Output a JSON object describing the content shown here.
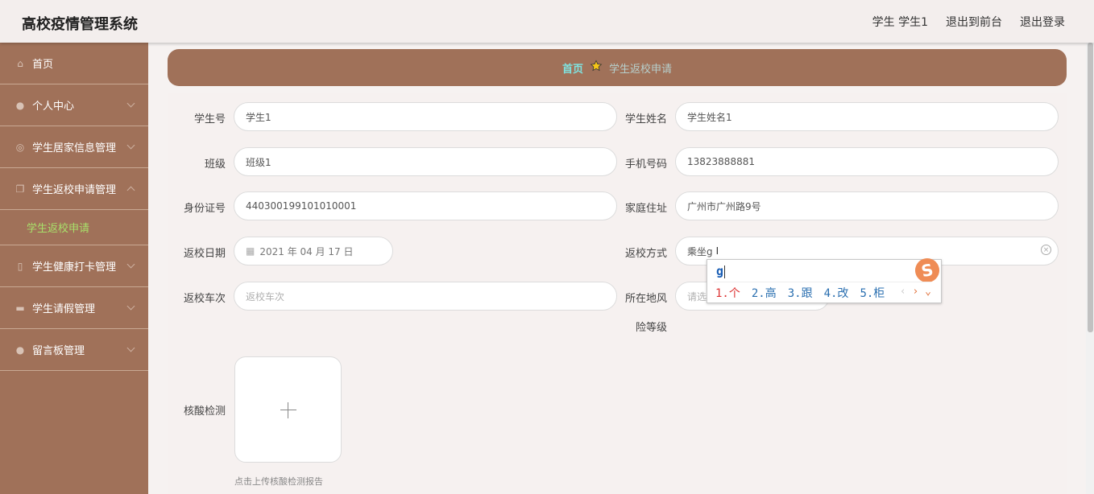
{
  "app": {
    "title": "高校疫情管理系统"
  },
  "topnav": {
    "user": "学生 学生1",
    "front": "退出到前台",
    "logout": "退出登录"
  },
  "sidebar": {
    "items": [
      {
        "label": "首页",
        "icon": "home-icon"
      },
      {
        "label": "个人中心",
        "icon": "user-icon"
      },
      {
        "label": "学生居家信息管理",
        "icon": "settings-icon"
      },
      {
        "label": "学生返校申请管理",
        "icon": "copy-icon"
      },
      {
        "label": "学生健康打卡管理",
        "icon": "phone-icon"
      },
      {
        "label": "学生请假管理",
        "icon": "chat-icon"
      },
      {
        "label": "留言板管理",
        "icon": "user-icon"
      }
    ],
    "sub_item": "学生返校申请"
  },
  "breadcrumb": {
    "home": "首页",
    "current": "学生返校申请"
  },
  "form": {
    "student_no_label": "学生号",
    "student_no": "学生1",
    "student_name_label": "学生姓名",
    "student_name": "学生姓名1",
    "class_label": "班级",
    "class": "班级1",
    "phone_label": "手机号码",
    "phone": "13823888881",
    "id_label": "身份证号",
    "id": "440300199101010001",
    "address_label": "家庭住址",
    "address": "广州市广州路9号",
    "return_date_label": "返校日期",
    "return_date": "2021 年 04 月 17 日",
    "return_method_label": "返校方式",
    "return_method": "乘坐g",
    "train_label": "返校车次",
    "train_placeholder": "返校车次",
    "risk_label_1": "所在地风",
    "risk_label_2": "险等级",
    "risk_placeholder": "请选",
    "nucleic_label": "核酸检测",
    "upload_hint": "点击上传核酸检测报告"
  },
  "ime": {
    "composition": "g",
    "candidates": [
      "1.个",
      "2.高",
      "3.跟",
      "4.改",
      "5.柜"
    ],
    "logo": "S"
  }
}
